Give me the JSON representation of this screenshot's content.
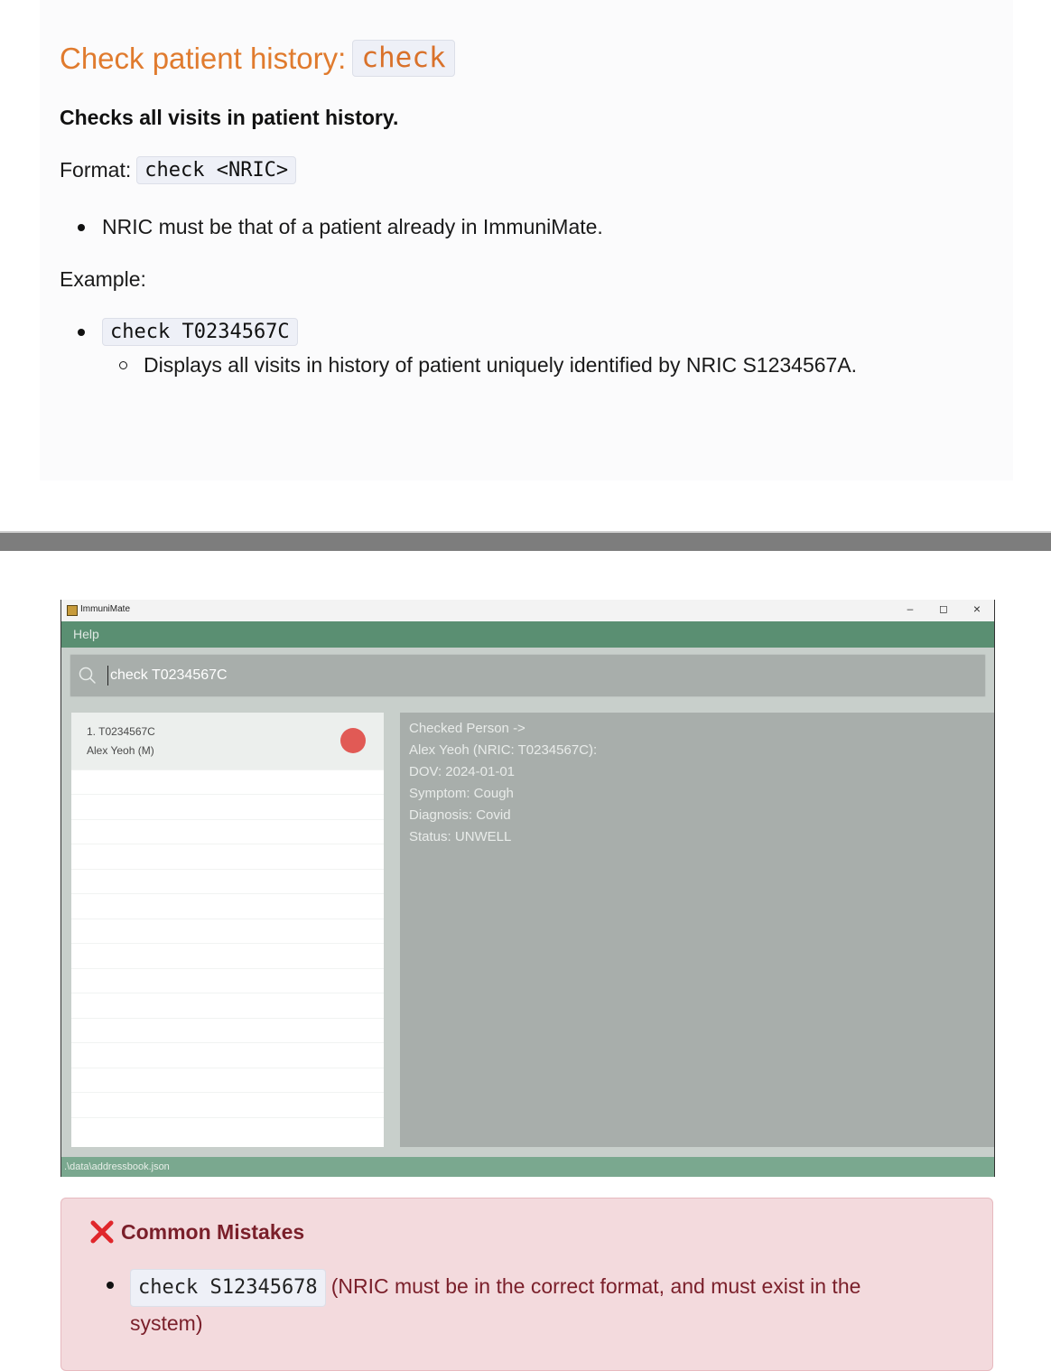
{
  "doc": {
    "heading_text": "Check patient history:",
    "heading_code": "check",
    "subheading": "Checks all visits in patient history.",
    "format_label": "Format:",
    "format_code": "check <NRIC>",
    "constraint": "NRIC must be that of a patient already in ImmuniMate.",
    "example_label": "Example:",
    "example_code": "check T0234567C",
    "example_description": "Displays all visits in history of patient uniquely identified by NRIC S1234567A."
  },
  "app": {
    "window_title": "ImmuniMate",
    "window_buttons": {
      "minimize": "–",
      "maximize": "◻",
      "close": "×"
    },
    "menu": {
      "help": "Help"
    },
    "command": {
      "value": "check T0234567C",
      "icon": "search-icon"
    },
    "list": {
      "items": [
        {
          "index_id": "1.  T0234567C",
          "name_gender": "Alex Yeoh (M)",
          "status_color": "#e15a55"
        }
      ]
    },
    "detail": {
      "lines": [
        "Checked Person ->",
        "Alex Yeoh (NRIC: T0234567C):",
        "DOV: 2024-01-01",
        "Symptom: Cough",
        "Diagnosis: Covid",
        "Status: UNWELL"
      ]
    },
    "status_bar": {
      "path": ".\\data\\addressbook.json"
    },
    "colors": {
      "menubar": "#5a8f72",
      "statusbar": "#7aa88f",
      "detail_bg": "#a8aeab"
    }
  },
  "mistakes": {
    "icon": "cross-icon",
    "title": "Common Mistakes",
    "items": [
      {
        "code": "check S12345678",
        "explanation": "(NRIC must be in the correct format, and must exist in the system)"
      }
    ]
  },
  "colors": {
    "heading": "#e07b2e",
    "mistakes_text": "#7a1f2a",
    "mistakes_bg": "#f3dadd"
  }
}
